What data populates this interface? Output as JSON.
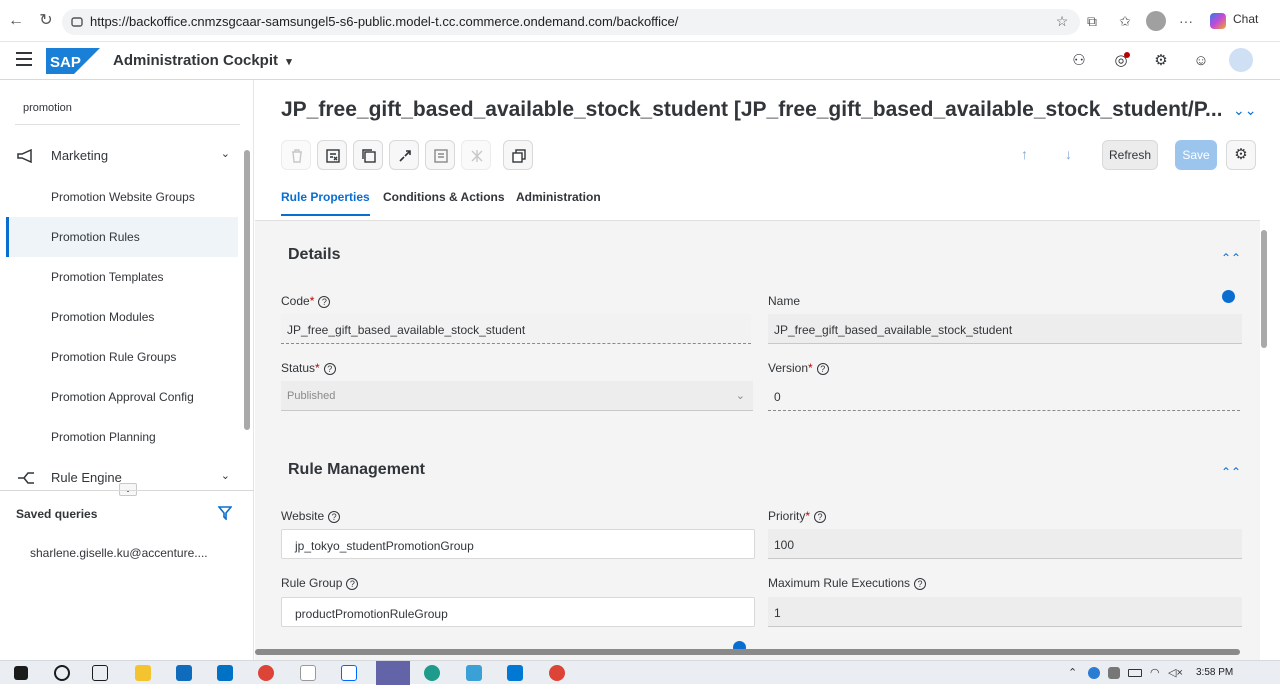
{
  "browser": {
    "url": "https://backoffice.cnmzsgcaar-samsungel5-s6-public.model-t.cc.commerce.ondemand.com/backoffice/",
    "chat_label": "Chat"
  },
  "app": {
    "logo_text": "SAP",
    "title": "Administration Cockpit",
    "title_caret": "▾"
  },
  "sidebar": {
    "search_value": "promotion",
    "group_marketing": "Marketing",
    "items": [
      {
        "label": "Promotion Website Groups"
      },
      {
        "label": "Promotion Rules"
      },
      {
        "label": "Promotion Templates"
      },
      {
        "label": "Promotion Modules"
      },
      {
        "label": "Promotion Rule Groups"
      },
      {
        "label": "Promotion Approval Config"
      },
      {
        "label": "Promotion Planning"
      }
    ],
    "group_rule_engine": "Rule Engine",
    "saved_queries_title": "Saved queries",
    "saved_query_item": "sharlene.giselle.ku@accenture...."
  },
  "editor": {
    "title": "JP_free_gift_based_available_stock_student [JP_free_gift_based_available_stock_student/P...",
    "refresh_label": "Refresh",
    "save_label": "Save",
    "tabs": [
      {
        "label": "Rule Properties"
      },
      {
        "label": "Conditions & Actions"
      },
      {
        "label": "Administration"
      }
    ],
    "details": {
      "title": "Details",
      "code_label": "Code",
      "code_value": "JP_free_gift_based_available_stock_student",
      "name_label": "Name",
      "name_value": "JP_free_gift_based_available_stock_student",
      "status_label": "Status",
      "status_value": "Published",
      "version_label": "Version",
      "version_value": "0"
    },
    "rule_management": {
      "title": "Rule Management",
      "website_label": "Website",
      "website_value": "jp_tokyo_studentPromotionGroup",
      "priority_label": "Priority",
      "priority_value": "100",
      "rule_group_label": "Rule Group",
      "rule_group_value": "productPromotionRuleGroup",
      "max_exec_label": "Maximum Rule Executions",
      "max_exec_value": "1"
    }
  },
  "taskbar": {
    "time": "3:58 PM"
  }
}
